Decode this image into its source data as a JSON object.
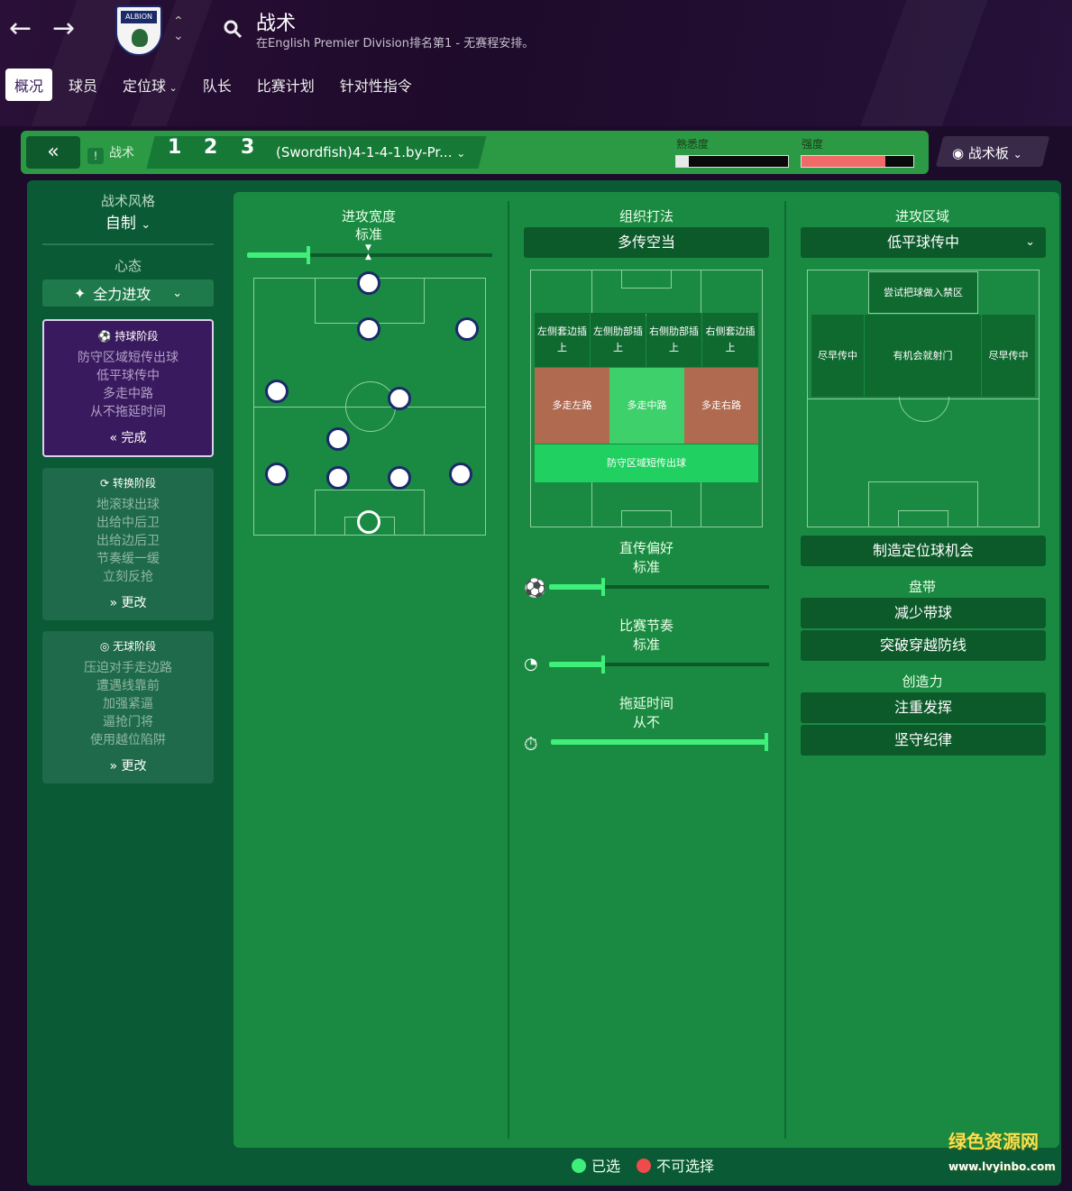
{
  "header": {
    "title": "战术",
    "subtitle": "在English Premier Division排名第1 - 无赛程安排。",
    "club_crest": "ALBION",
    "tabs": [
      "概况",
      "球员",
      "定位球",
      "队长",
      "比赛计划",
      "针对性指令"
    ]
  },
  "tactic_bar": {
    "label": "战术",
    "slots": [
      "1",
      "2",
      "3"
    ],
    "tactic_name": "(Swordfish)4-1-4-1.by-Pr...",
    "familiarity_label": "熟悉度",
    "intensity_label": "强度",
    "view_button": "战术板"
  },
  "left_panel": {
    "style_label": "战术风格",
    "style_value": "自制",
    "mentality_label": "心态",
    "mentality_value": "全力进攻",
    "phases": [
      {
        "title": "持球阶段",
        "items": [
          "防守区域短传出球",
          "低平球传中",
          "多走中路",
          "从不拖延时间"
        ],
        "footer": "完成"
      },
      {
        "title": "转换阶段",
        "items": [
          "地滚球出球",
          "出给中后卫",
          "出给边后卫",
          "节奏缓一缓",
          "立刻反抢"
        ],
        "footer": "更改"
      },
      {
        "title": "无球阶段",
        "items": [
          "压迫对手走边路",
          "遭遇线靠前",
          "加强紧逼",
          "逼抢门将",
          "使用越位陷阱"
        ],
        "footer": "更改"
      }
    ]
  },
  "col1": {
    "label": "进攻宽度",
    "value": "标准",
    "width_level": 0.25
  },
  "col2": {
    "label": "组织打法",
    "value": "多传空当",
    "zones": {
      "top": [
        "左侧套边插上",
        "左侧肋部插上",
        "右侧肋部插上",
        "右侧套边插上"
      ],
      "mid": [
        "多走左路",
        "多走中路",
        "多走右路"
      ],
      "bottom": "防守区域短传出球"
    },
    "passing_label": "直传偏好",
    "passing_value": "标准",
    "tempo_label": "比赛节奏",
    "tempo_value": "标准",
    "timewaste_label": "拖延时间",
    "timewaste_value": "从不"
  },
  "col3": {
    "label": "进攻区域",
    "value": "低平球传中",
    "zones": {
      "box": "尝试把球做入禁区",
      "left": "尽早传中",
      "center": "有机会就射门",
      "right": "尽早传中"
    },
    "setpiece": "制造定位球机会",
    "dribble_label": "盘带",
    "dribble_options": [
      "减少带球",
      "突破穿越防线"
    ],
    "creative_label": "创造力",
    "creative_options": [
      "注重发挥",
      "坚守纪律"
    ]
  },
  "legend": {
    "selected": "已选",
    "unavailable": "不可选择"
  },
  "watermark": "绿色资源网",
  "watermark_url": "www.lvyinbo.com",
  "colors": {
    "selected": "#3ef07a",
    "unavailable": "#f04a4a"
  }
}
